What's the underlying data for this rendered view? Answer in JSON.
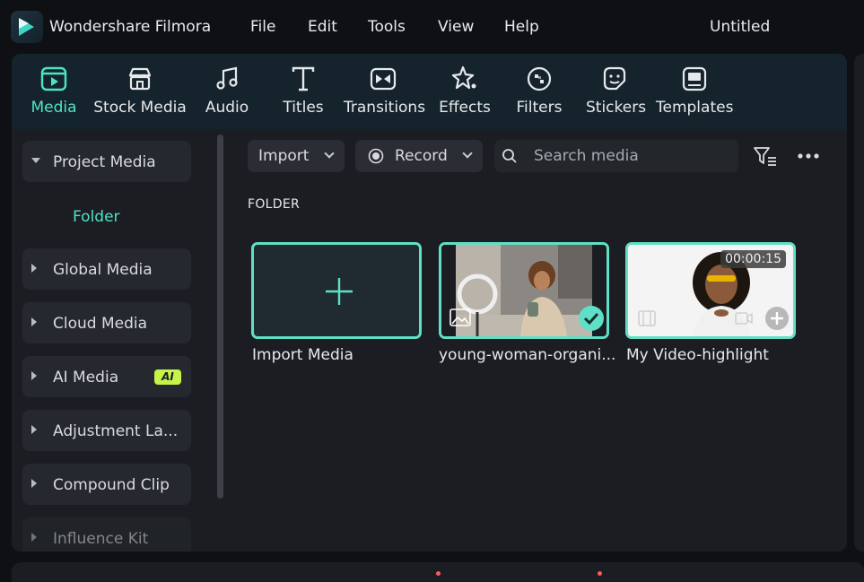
{
  "app": {
    "name": "Wondershare Filmora",
    "doc_title": "Untitled"
  },
  "menu": [
    "File",
    "Edit",
    "Tools",
    "View",
    "Help"
  ],
  "tabs": [
    {
      "label": "Media",
      "icon": "media-icon",
      "active": true
    },
    {
      "label": "Stock Media",
      "icon": "stock-media-icon"
    },
    {
      "label": "Audio",
      "icon": "music-note-icon"
    },
    {
      "label": "Titles",
      "icon": "titles-icon"
    },
    {
      "label": "Transitions",
      "icon": "transitions-icon"
    },
    {
      "label": "Effects",
      "icon": "effects-icon"
    },
    {
      "label": "Filters",
      "icon": "filters-icon"
    },
    {
      "label": "Stickers",
      "icon": "stickers-icon"
    },
    {
      "label": "Templates",
      "icon": "templates-icon"
    }
  ],
  "sidebar": {
    "project_media": "Project Media",
    "folder": "Folder",
    "items": [
      "Global Media",
      "Cloud Media",
      "AI Media",
      "Adjustment La...",
      "Compound Clip",
      "Influence Kit"
    ],
    "ai_badge": "AI"
  },
  "toolbar": {
    "import_label": "Import",
    "record_label": "Record",
    "search_placeholder": "Search media"
  },
  "content": {
    "folder_heading": "FOLDER",
    "cards": [
      {
        "label": "Import Media"
      },
      {
        "label": "young-woman-organi..."
      },
      {
        "label": "My Video-highlight",
        "duration": "00:00:15"
      }
    ]
  },
  "colors": {
    "accent": "#4fe3c6",
    "card_border": "#5fe0c6",
    "ai_badge": "#c6f24a"
  }
}
